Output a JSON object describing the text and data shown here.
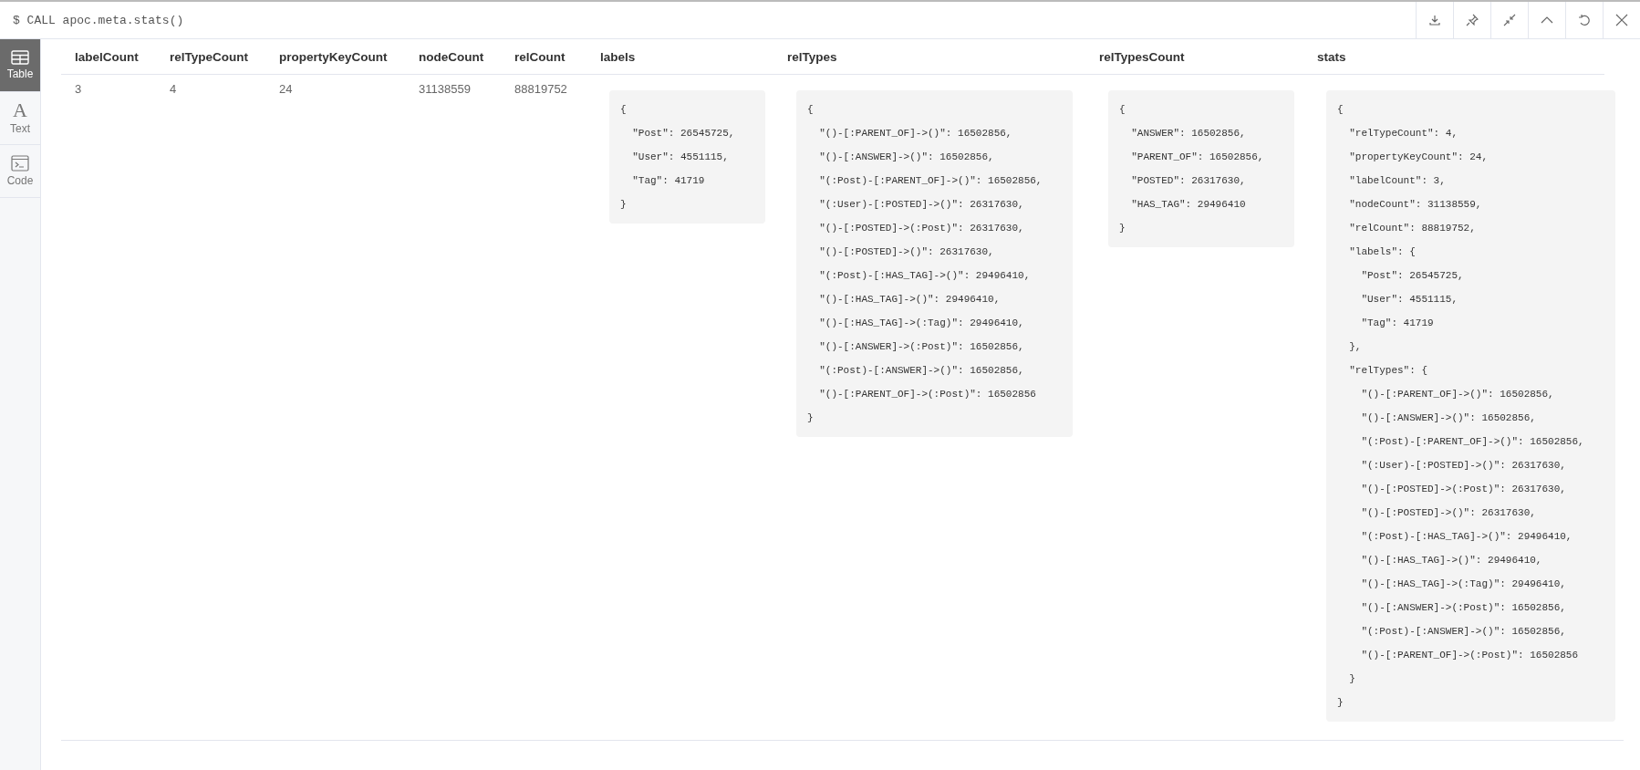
{
  "query": "$ CALL apoc.meta.stats()",
  "view_tabs": [
    {
      "label": "Table",
      "kind": "table",
      "selected": true
    },
    {
      "label": "Text",
      "kind": "text",
      "icon": "A",
      "selected": false
    },
    {
      "label": "Code",
      "kind": "code",
      "selected": false
    }
  ],
  "table": {
    "columns": [
      "labelCount",
      "relTypeCount",
      "propertyKeyCount",
      "nodeCount",
      "relCount",
      "labels",
      "relTypes",
      "relTypesCount",
      "stats"
    ],
    "rows": [
      {
        "cells": [
          {
            "kind": "text",
            "value": "3"
          },
          {
            "kind": "text",
            "value": "4"
          },
          {
            "kind": "text",
            "value": "24"
          },
          {
            "kind": "text",
            "value": "31138559"
          },
          {
            "kind": "text",
            "value": "88819752"
          },
          {
            "kind": "code",
            "lines": [
              "{",
              "  \"Post\": 26545725,",
              "  \"User\": 4551115,",
              "  \"Tag\": 41719",
              "}"
            ]
          },
          {
            "kind": "code",
            "lines": [
              "{",
              "  \"()-[:PARENT_OF]->()\": 16502856,",
              "  \"()-[:ANSWER]->()\": 16502856,",
              "  \"(:Post)-[:PARENT_OF]->()\": 16502856,",
              "  \"(:User)-[:POSTED]->()\": 26317630,",
              "  \"()-[:POSTED]->(:Post)\": 26317630,",
              "  \"()-[:POSTED]->()\": 26317630,",
              "  \"(:Post)-[:HAS_TAG]->()\": 29496410,",
              "  \"()-[:HAS_TAG]->()\": 29496410,",
              "  \"()-[:HAS_TAG]->(:Tag)\": 29496410,",
              "  \"()-[:ANSWER]->(:Post)\": 16502856,",
              "  \"(:Post)-[:ANSWER]->()\": 16502856,",
              "  \"()-[:PARENT_OF]->(:Post)\": 16502856",
              "}"
            ]
          },
          {
            "kind": "code",
            "lines": [
              "{",
              "  \"ANSWER\": 16502856,",
              "  \"PARENT_OF\": 16502856,",
              "  \"POSTED\": 26317630,",
              "  \"HAS_TAG\": 29496410",
              "}"
            ]
          },
          {
            "kind": "code",
            "lines": [
              "{",
              "  \"relTypeCount\": 4,",
              "  \"propertyKeyCount\": 24,",
              "  \"labelCount\": 3,",
              "  \"nodeCount\": 31138559,",
              "  \"relCount\": 88819752,",
              "  \"labels\": {",
              "    \"Post\": 26545725,",
              "    \"User\": 4551115,",
              "    \"Tag\": 41719",
              "  },",
              "  \"relTypes\": {",
              "    \"()-[:PARENT_OF]->()\": 16502856,",
              "    \"()-[:ANSWER]->()\": 16502856,",
              "    \"(:Post)-[:PARENT_OF]->()\": 16502856,",
              "    \"(:User)-[:POSTED]->()\": 26317630,",
              "    \"()-[:POSTED]->(:Post)\": 26317630,",
              "    \"()-[:POSTED]->()\": 26317630,",
              "    \"(:Post)-[:HAS_TAG]->()\": 29496410,",
              "    \"()-[:HAS_TAG]->()\": 29496410,",
              "    \"()-[:HAS_TAG]->(:Tag)\": 29496410,",
              "    \"()-[:ANSWER]->(:Post)\": 16502856,",
              "    \"(:Post)-[:ANSWER]->()\": 16502856,",
              "    \"()-[:PARENT_OF]->(:Post)\": 16502856",
              "  }",
              "}"
            ]
          }
        ]
      }
    ]
  }
}
